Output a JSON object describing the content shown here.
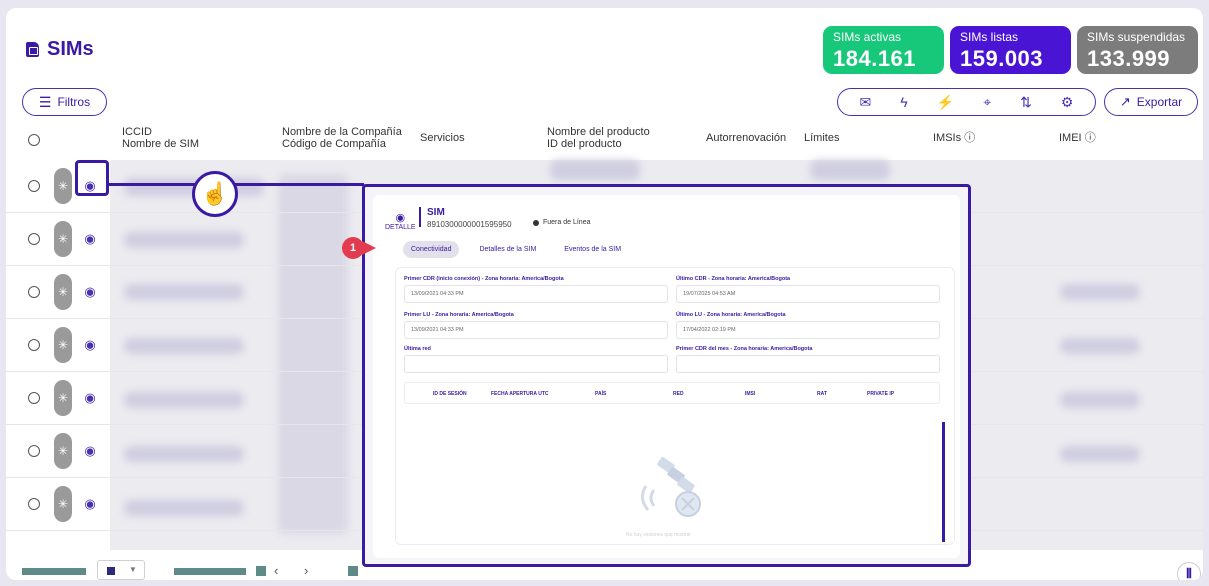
{
  "page": {
    "title": "SIMs"
  },
  "stats": [
    {
      "label": "SIMs activas",
      "value": "184.161",
      "color": "#17c87a"
    },
    {
      "label": "SIMs listas",
      "value": "159.003",
      "color": "#4a14d4"
    },
    {
      "label": "SIMs suspendidas",
      "value": "133.999",
      "color": "#7c7c7c"
    }
  ],
  "toolbar": {
    "filters_label": "Filtros",
    "export_label": "Exportar",
    "action_icons": [
      "mail-icon",
      "lightning-icon",
      "lightning-off-icon",
      "location-pin-icon",
      "transfer-icon",
      "sim-settings-icon"
    ]
  },
  "table": {
    "headers": {
      "iccid": "ICCID",
      "sim_name": "Nombre de SIM",
      "company_name": "Nombre de la Compañía",
      "company_code": "Código de Compañía",
      "services": "Servicios",
      "product_name": "Nombre del producto",
      "product_id": "ID del producto",
      "auto_renew": "Autorrenovación",
      "limits": "Límites",
      "imsis": "IMSIs",
      "imei": "IMEI"
    },
    "row_count": 7
  },
  "detail": {
    "detail_label": "DETALLE",
    "sim_title": "SIM",
    "sim_number": "8910300000001595950",
    "status": "Fuera de Línea",
    "tabs": [
      "Conectividad",
      "Detalles de la SIM",
      "Eventos de la SIM"
    ],
    "active_tab": "Conectividad",
    "fields": [
      {
        "label": "Primer CDR (inicio conexión) - Zona horaria: America/Bogota",
        "value": "13/09/2021 04:33 PM"
      },
      {
        "label": "Último CDR - Zona horaria: America/Bogota",
        "value": "19/07/2025 04:53 AM"
      },
      {
        "label": "Primer LU - Zona horaria: America/Bogota",
        "value": "13/09/2021 04:33 PM"
      },
      {
        "label": "Último LU - Zona horaria: America/Bogota",
        "value": "17/04/2022 02:19 PM"
      },
      {
        "label": "Última red",
        "value": ""
      },
      {
        "label": "Primer CDR del mes - Zona horaria: America/Bogota",
        "value": ""
      }
    ],
    "session_table_headers": [
      "ID DE SESIÓN",
      "FECHA APERTURA UTC",
      "PAÍS",
      "RED",
      "IMSI",
      "RAT",
      "PRIVATE IP"
    ],
    "empty_message": "No hay sesiones que mostrar"
  },
  "callout": {
    "number": "1"
  }
}
